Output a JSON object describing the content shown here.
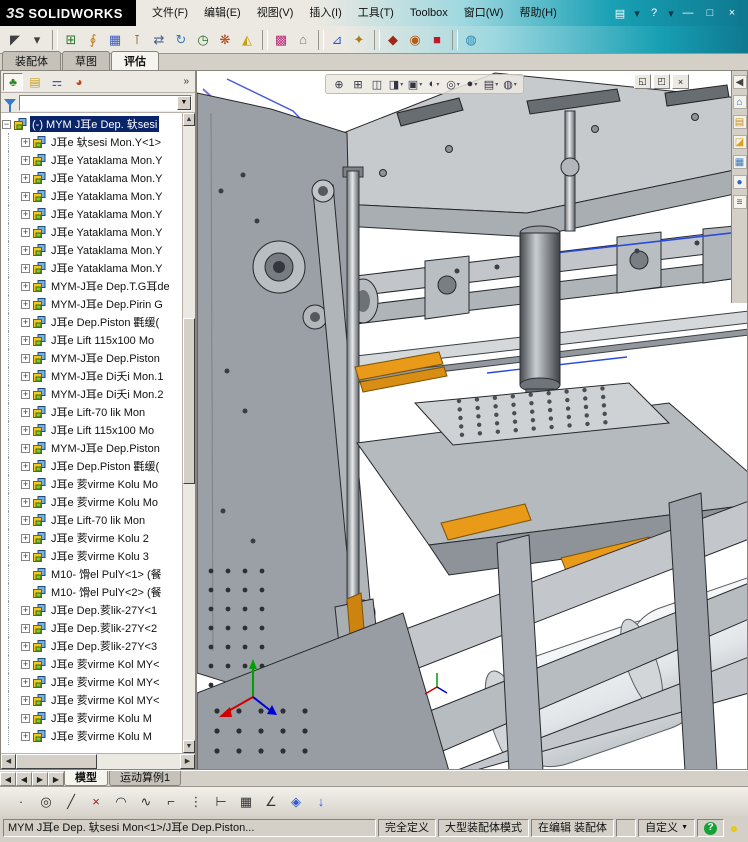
{
  "titlebar": {
    "logo_mark": "3S",
    "logo_name": "SOLIDWORKS",
    "menus": [
      "文件(F)",
      "编辑(E)",
      "视图(V)",
      "插入(I)",
      "工具(T)",
      "Toolbox",
      "窗口(W)",
      "帮助(H)"
    ],
    "icons": [
      {
        "name": "new-document-icon",
        "glyph": "▤"
      },
      {
        "name": "dropdown-icon",
        "glyph": "▾"
      },
      {
        "name": "help-icon",
        "glyph": "?"
      },
      {
        "name": "dropdown-icon",
        "glyph": "▾"
      },
      {
        "name": "minimize-icon",
        "glyph": "―"
      },
      {
        "name": "maximize-icon",
        "glyph": "□"
      },
      {
        "name": "close-icon",
        "glyph": "×"
      }
    ]
  },
  "toolbar": {
    "icons": [
      {
        "name": "select-icon",
        "glyph": "◤",
        "color": "#404040"
      },
      {
        "name": "dropdown-icon",
        "glyph": "▾",
        "color": "#404040"
      },
      {
        "sep": true
      },
      {
        "name": "insert-component-icon",
        "glyph": "⊞",
        "color": "#2a7a2a"
      },
      {
        "name": "mate-icon",
        "glyph": "∮",
        "color": "#c07820"
      },
      {
        "name": "component-pattern-icon",
        "glyph": "▦",
        "color": "#3a5ac0"
      },
      {
        "name": "smart-fasteners-icon",
        "glyph": "⊺",
        "color": "#806020"
      },
      {
        "name": "move-component-icon",
        "glyph": "⇄",
        "color": "#406080"
      },
      {
        "name": "rotate-component-icon",
        "glyph": "↻",
        "color": "#3a78b8"
      },
      {
        "name": "clock-icon",
        "glyph": "◷",
        "color": "#2a6a2a"
      },
      {
        "name": "exploded-view-icon",
        "glyph": "❋",
        "color": "#b04818"
      },
      {
        "name": "interference-icon",
        "glyph": "◭",
        "color": "#c8a010"
      },
      {
        "sep": true
      },
      {
        "name": "appearance-palette-icon",
        "glyph": "▩",
        "color": "#c02878"
      },
      {
        "name": "scene-icon",
        "glyph": "⌂",
        "color": "#787878"
      },
      {
        "sep": true
      },
      {
        "name": "simulation-icon",
        "glyph": "⊿",
        "color": "#2a5ac0"
      },
      {
        "name": "motion-icon",
        "glyph": "✦",
        "color": "#b07818"
      },
      {
        "sep": true
      },
      {
        "name": "toolbox-icon",
        "glyph": "◆",
        "color": "#a02818"
      },
      {
        "name": "routing-icon",
        "glyph": "◉",
        "color": "#b85a10"
      },
      {
        "name": "render-icon",
        "glyph": "■",
        "color": "#c01828"
      },
      {
        "sep": true
      },
      {
        "name": "photoview-icon",
        "glyph": "◍",
        "color": "#2888b8"
      }
    ]
  },
  "command_tabs": [
    {
      "label": "装配体",
      "active": false
    },
    {
      "label": "草图",
      "active": false
    },
    {
      "label": "评估",
      "active": true
    }
  ],
  "panel": {
    "header_icons": [
      {
        "name": "featuremanager-tab-icon",
        "glyph": "♣",
        "color": "#2a8a2a",
        "selected": true
      },
      {
        "name": "propertymanager-tab-icon",
        "glyph": "▤",
        "color": "#c8a018",
        "selected": false
      },
      {
        "name": "configurationmanager-tab-icon",
        "glyph": "⚎",
        "color": "#3a5ac0",
        "selected": false
      },
      {
        "name": "displaymanager-tab-icon",
        "glyph": "◕",
        "color": "#c04818",
        "selected": false
      }
    ],
    "overflow_label": "»"
  },
  "tree": {
    "items": [
      {
        "label": "(-) MYM J耳e Dep. 轪sesi",
        "plus": true,
        "expanded": true,
        "selected": true
      },
      {
        "label": "J耳e 轪sesi Mon.Y<1>",
        "plus": true
      },
      {
        "label": "J耳e Yataklama Mon.Y",
        "plus": true
      },
      {
        "label": "J耳e Yataklama Mon.Y",
        "plus": true
      },
      {
        "label": "J耳e Yataklama Mon.Y",
        "plus": true
      },
      {
        "label": "J耳e Yataklama Mon.Y",
        "plus": true
      },
      {
        "label": "J耳e Yataklama Mon.Y",
        "plus": true
      },
      {
        "label": "J耳e Yataklama Mon.Y",
        "plus": true
      },
      {
        "label": "J耳e Yataklama Mon.Y",
        "plus": true
      },
      {
        "label": "MYM-J耳e Dep.T.G耳de",
        "plus": true
      },
      {
        "label": "MYM-J耳e Dep.Pirin G",
        "plus": true
      },
      {
        "label": "J耳e Dep.Piston 氍缓(",
        "plus": true
      },
      {
        "label": "J耳e Lift 115x100 Mo",
        "plus": true
      },
      {
        "label": "MYM-J耳e Dep.Piston",
        "plus": true
      },
      {
        "label": "MYM-J耳e Di夭i Mon.1",
        "plus": true
      },
      {
        "label": "MYM-J耳e Di夭i Mon.2",
        "plus": true
      },
      {
        "label": "J耳e Lift-70 lik Mon",
        "plus": true
      },
      {
        "label": "J耳e Lift 115x100 Mo",
        "plus": true
      },
      {
        "label": "MYM-J耳e Dep.Piston",
        "plus": true
      },
      {
        "label": "J耳e Dep.Piston 氍缓(",
        "plus": true
      },
      {
        "label": "J耳e 荄virme Kolu Mo",
        "plus": true
      },
      {
        "label": "J耳e 荄virme Kolu Mo",
        "plus": true
      },
      {
        "label": "J耳e Lift-70 lik Mon",
        "plus": true
      },
      {
        "label": "J耳e 荄virme Kolu 2",
        "plus": true
      },
      {
        "label": "J耳e 荄virme Kolu 3",
        "plus": true
      },
      {
        "label": "M10- 馉el PulY<1> (餐",
        "plus": false
      },
      {
        "label": "M10- 馉el PulY<2> (餐",
        "plus": false
      },
      {
        "label": "J耳e Dep.荄lik-27Y<1",
        "plus": true
      },
      {
        "label": "J耳e Dep.荄lik-27Y<2",
        "plus": true
      },
      {
        "label": "J耳e Dep.荄lik-27Y<3",
        "plus": true
      },
      {
        "label": "J耳e 荄virme Kol MY<",
        "plus": true
      },
      {
        "label": "J耳e 荄virme Kol MY<",
        "plus": true
      },
      {
        "label": "J耳e 荄virme Kol MY<",
        "plus": true
      },
      {
        "label": "J耳e 荄virme Kolu M",
        "plus": true
      },
      {
        "label": "J耳e 荄virme Kolu M",
        "plus": true
      }
    ]
  },
  "viewport": {
    "headsup_icons": [
      {
        "name": "zoom-fit-icon",
        "glyph": "⊕"
      },
      {
        "name": "zoom-area-icon",
        "glyph": "⊞"
      },
      {
        "name": "previous-view-icon",
        "glyph": "◫"
      },
      {
        "name": "section-view-icon",
        "glyph": "◨",
        "arrow": true
      },
      {
        "name": "view-orientation-icon",
        "glyph": "▣",
        "arrow": true
      },
      {
        "name": "display-style-icon",
        "glyph": "◐",
        "arrow": true
      },
      {
        "name": "hide-show-items-icon",
        "glyph": "◎",
        "arrow": true
      },
      {
        "name": "edit-appearance-icon",
        "glyph": "●",
        "arrow": true
      },
      {
        "name": "apply-scene-icon",
        "glyph": "▤",
        "arrow": true
      },
      {
        "name": "view-settings-icon",
        "glyph": "◍",
        "arrow": true
      }
    ],
    "window_buttons": [
      {
        "name": "doc-restore-icon",
        "glyph": "◱"
      },
      {
        "name": "doc-maximize-icon",
        "glyph": "◰"
      },
      {
        "name": "doc-close-icon",
        "glyph": "×"
      }
    ],
    "taskpane_icons": [
      {
        "name": "collapse-taskpane-icon",
        "glyph": "◀",
        "color": "#444"
      },
      {
        "name": "solidworks-resources-icon",
        "glyph": "⌂",
        "color": "#1b64c8"
      },
      {
        "name": "design-library-icon",
        "glyph": "▤",
        "color": "#c89010"
      },
      {
        "name": "file-explorer-icon",
        "glyph": "◪",
        "color": "#e0a018"
      },
      {
        "name": "view-palette-icon",
        "glyph": "▦",
        "color": "#3878c8"
      },
      {
        "name": "appearances-icon",
        "glyph": "●",
        "color": "#2868c8"
      },
      {
        "name": "custom-properties-icon",
        "glyph": "≡",
        "color": "#555555"
      }
    ]
  },
  "doc_tabs": {
    "nav": [
      "◀",
      "◀",
      "▶",
      "▶"
    ],
    "tabs": [
      {
        "label": "模型",
        "active": true
      },
      {
        "label": "运动算例1",
        "active": false
      }
    ]
  },
  "sketch_toolbar": {
    "icons": [
      {
        "name": "point-icon",
        "glyph": "·",
        "color": "#333"
      },
      {
        "name": "circle-icon",
        "glyph": "◎",
        "color": "#333"
      },
      {
        "name": "line-icon",
        "glyph": "╱",
        "color": "#333"
      },
      {
        "name": "erase-icon",
        "glyph": "×",
        "color": "#a02020"
      },
      {
        "name": "arc-icon",
        "glyph": "◠",
        "color": "#333"
      },
      {
        "name": "spline-icon",
        "glyph": "∿",
        "color": "#333"
      },
      {
        "name": "corner-icon",
        "glyph": "⌐",
        "color": "#333"
      },
      {
        "name": "centerline-icon",
        "glyph": "⋮",
        "color": "#333"
      },
      {
        "name": "trim-icon",
        "glyph": "⊢",
        "color": "#333"
      },
      {
        "name": "grid-icon",
        "glyph": "▦",
        "color": "#333"
      },
      {
        "name": "angle-icon",
        "glyph": "∠",
        "color": "#333"
      },
      {
        "name": "isometric-cube-icon",
        "glyph": "◈",
        "color": "#2a5ad8"
      },
      {
        "name": "arrow-down-icon",
        "glyph": "↓",
        "color": "#2a5ad8"
      }
    ]
  },
  "statusbar": {
    "message": "MYM J耳e Dep. 轪sesi Mon<1>/J耳e Dep.Piston...",
    "fully_defined": "完全定义",
    "large_assembly": "大型装配体模式",
    "editing": "在编辑 装配体",
    "custom": "自定义"
  }
}
